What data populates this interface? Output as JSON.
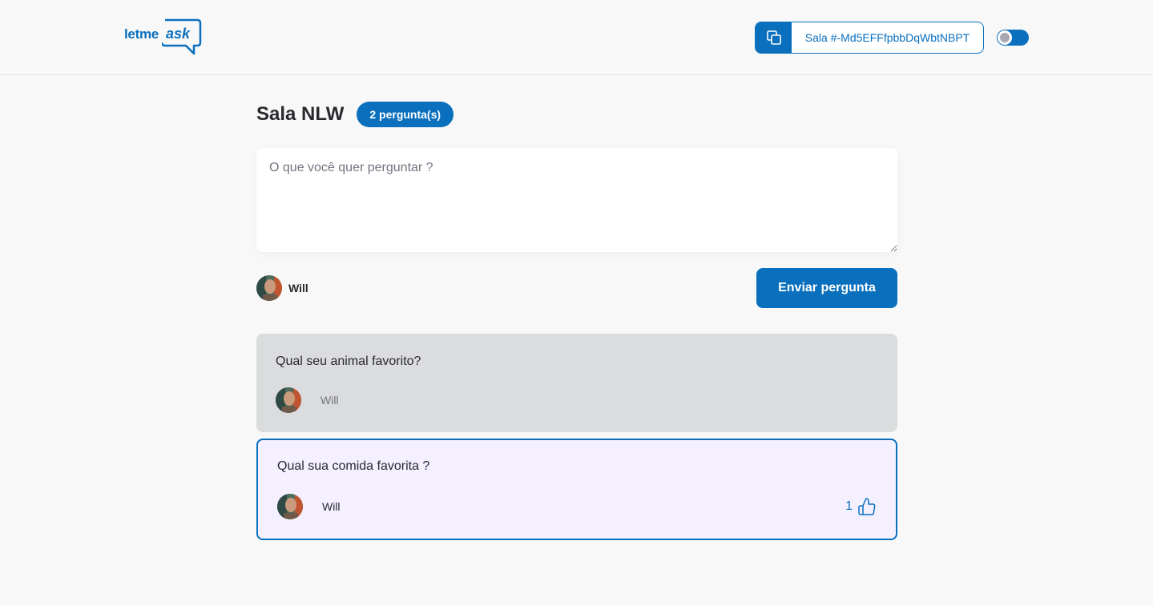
{
  "header": {
    "logo": {
      "part1": "letme",
      "part2": "ask"
    },
    "room_code_label": "Sala #-Md5EFFfpbbDqWbtNBPT"
  },
  "main": {
    "title": "Sala NLW",
    "count_badge": "2 pergunta(s)",
    "question_placeholder": "O que você quer perguntar ?",
    "user_name": "Will",
    "send_button": "Enviar pergunta"
  },
  "questions": [
    {
      "text": "Qual seu animal favorito?",
      "author": "Will",
      "state": "answered"
    },
    {
      "text": "Qual sua comida favorita ?",
      "author": "Will",
      "state": "highlighted",
      "likes": "1"
    }
  ],
  "colors": {
    "primary": "#0a6fbd",
    "background": "#f8f8f8",
    "answered_bg": "#dbdcdd",
    "highlight_bg": "#f4f0ff"
  },
  "icons": [
    "copy-icon",
    "theme-toggle",
    "like-icon"
  ]
}
